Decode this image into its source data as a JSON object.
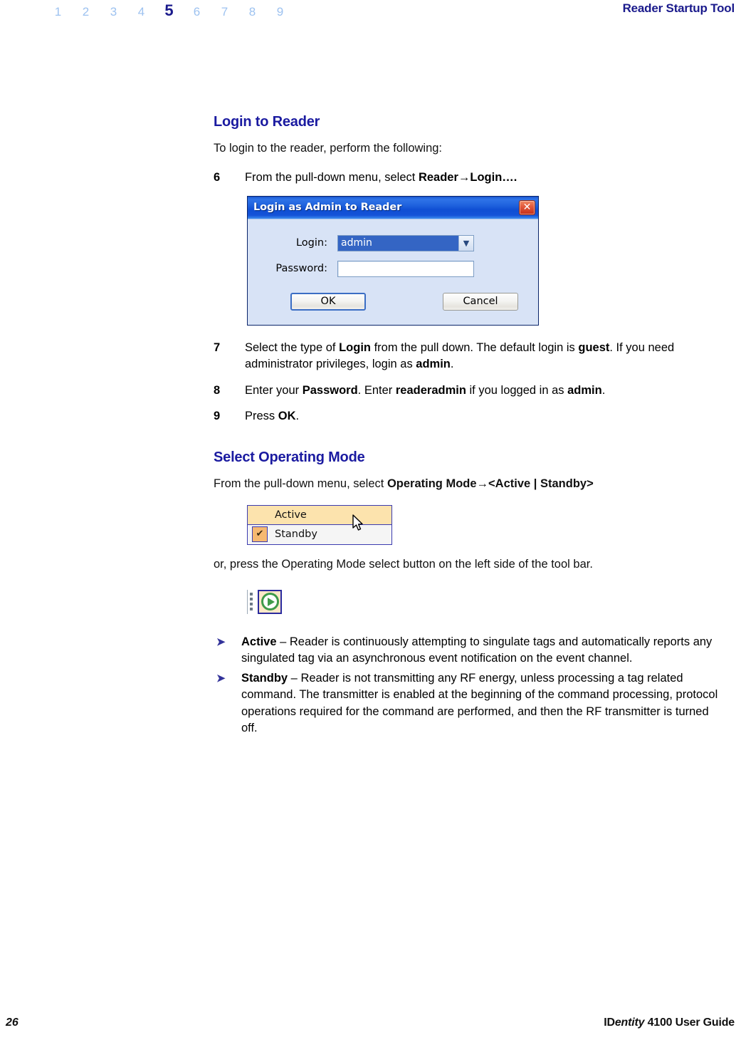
{
  "header": {
    "chapter_numbers": [
      "1",
      "2",
      "3",
      "4",
      "5",
      "6",
      "7",
      "8",
      "9"
    ],
    "current_chapter": "5",
    "title": "Reader Startup Tool",
    "accent_color": "#1a1a8c",
    "inactive_color": "#9dc2f0"
  },
  "sections": {
    "login": {
      "heading": "Login to Reader",
      "intro": "To login to the reader, perform the following:",
      "steps": [
        {
          "number": "6",
          "parts": [
            {
              "text": "From the pull-down menu, select ",
              "bold": false
            },
            {
              "text": "Reader→Login….",
              "bold": true
            }
          ]
        },
        {
          "number": "7",
          "parts": [
            {
              "text": "Select the type of ",
              "bold": false
            },
            {
              "text": "Login",
              "bold": true
            },
            {
              "text": " from the pull down. The default login is ",
              "bold": false
            },
            {
              "text": "guest",
              "bold": true
            },
            {
              "text": ". If you need administrator privileges, login as ",
              "bold": false
            },
            {
              "text": "admin",
              "bold": true
            },
            {
              "text": ".",
              "bold": false
            }
          ]
        },
        {
          "number": "8",
          "parts": [
            {
              "text": "Enter your ",
              "bold": false
            },
            {
              "text": "Password",
              "bold": true
            },
            {
              "text": ". Enter ",
              "bold": false
            },
            {
              "text": "readeradmin",
              "bold": true
            },
            {
              "text": " if you logged in as ",
              "bold": false
            },
            {
              "text": "admin",
              "bold": true
            },
            {
              "text": ".",
              "bold": false
            }
          ]
        },
        {
          "number": "9",
          "parts": [
            {
              "text": "Press ",
              "bold": false
            },
            {
              "text": "OK",
              "bold": true
            },
            {
              "text": ".",
              "bold": false
            }
          ]
        }
      ]
    },
    "operating_mode": {
      "heading": "Select Operating Mode",
      "intro_parts": [
        {
          "text": "From the pull-down menu, select ",
          "bold": false
        },
        {
          "text": "Operating Mode→<Active | Standby>",
          "bold": true
        }
      ],
      "alt_text": "or, press the Operating Mode select button on the left side of the tool bar.",
      "bullets": [
        {
          "marker": "➤",
          "parts": [
            {
              "text": "Active",
              "bold": true
            },
            {
              "text": " – Reader is continuously attempting to singulate tags and automatically reports any singulated tag via an asynchronous event notification on the event channel.",
              "bold": false
            }
          ]
        },
        {
          "marker": "➤",
          "parts": [
            {
              "text": "Standby",
              "bold": true
            },
            {
              "text": " – Reader is not transmitting any RF energy, unless processing a tag related command. The transmitter is enabled at the beginning of the command processing, protocol operations required for the command are performed, and then the RF transmitter is turned off.",
              "bold": false
            }
          ]
        }
      ]
    }
  },
  "login_dialog": {
    "title": "Login as Admin to Reader",
    "close_glyph": "✕",
    "login_label": "Login:",
    "login_value": "admin",
    "login_dropdown_glyph": "▼",
    "password_label": "Password:",
    "password_value": "",
    "ok_label": "OK",
    "cancel_label": "Cancel",
    "titlebar_color": "#1d60dd",
    "close_color": "#c32f18"
  },
  "mode_menu": {
    "items": [
      {
        "label": "Active",
        "checked": false,
        "highlighted": true
      },
      {
        "label": "Standby",
        "checked": true,
        "highlighted": false
      }
    ],
    "check_glyph": "✔",
    "highlight_color": "#fce3ad",
    "check_color": "#f6b971"
  },
  "toolbar_button": {
    "name": "Operating Mode select button",
    "icon": "green-play-circle-icon",
    "icon_color": "#3f9b4a",
    "background_color": "#fde8c8"
  },
  "footer": {
    "page_number": "26",
    "guide_prefix": "ID",
    "guide_italic": "entity",
    "guide_suffix": " 4100 User Guide"
  }
}
